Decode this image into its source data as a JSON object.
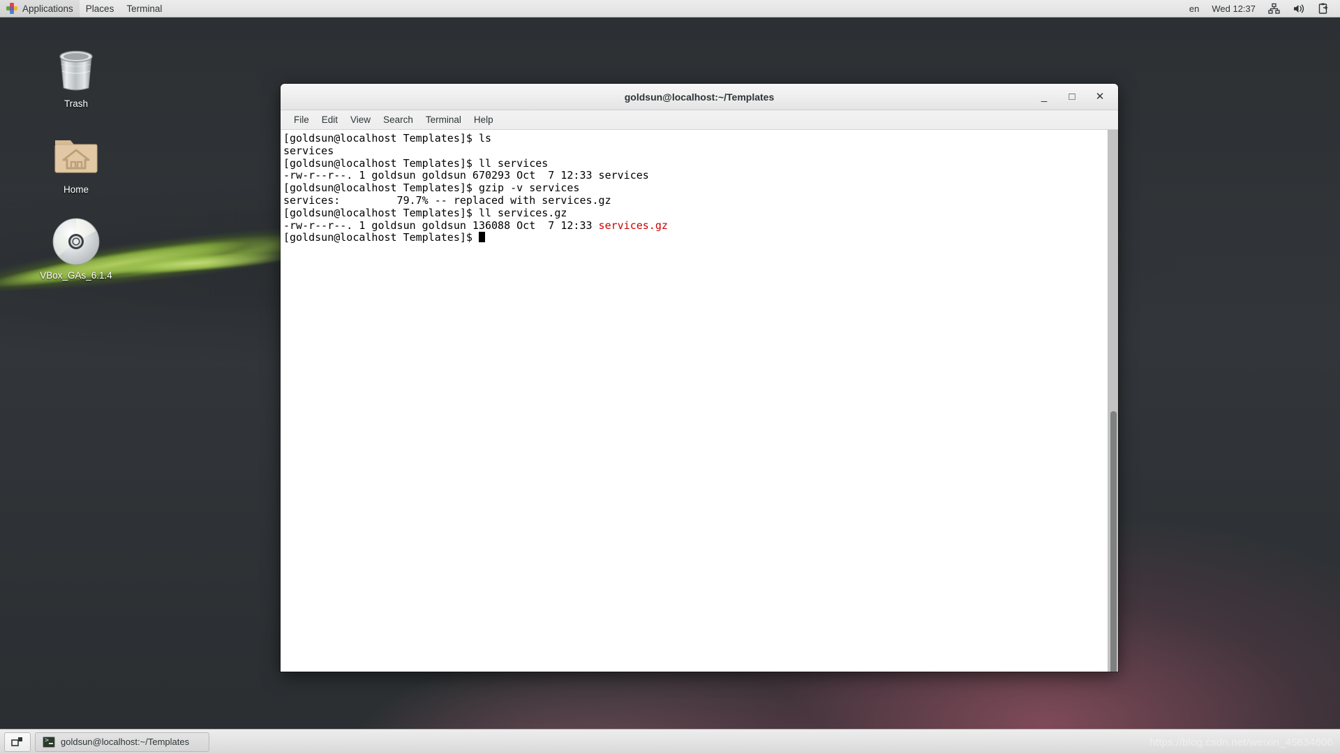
{
  "top_panel": {
    "apps_icon": "applications-pinwheel-icon",
    "menus": [
      {
        "label": "Applications"
      },
      {
        "label": "Places"
      },
      {
        "label": "Terminal"
      }
    ],
    "right": {
      "keyboard_layout": "en",
      "clock": "Wed 12:37",
      "tray_icons": [
        {
          "name": "network-icon"
        },
        {
          "name": "volume-icon"
        },
        {
          "name": "clipboard-icon"
        }
      ]
    }
  },
  "desktop": {
    "icons": [
      {
        "name": "trash-icon",
        "label": "Trash"
      },
      {
        "name": "home-folder-icon",
        "label": "Home"
      },
      {
        "name": "cd-disc-icon",
        "label": "VBox_GAs_6.1.4"
      }
    ]
  },
  "terminal": {
    "title": "goldsun@localhost:~/Templates",
    "window_buttons": {
      "minimize": "_",
      "maximize": "□",
      "close": "✕"
    },
    "menu": [
      {
        "label": "File"
      },
      {
        "label": "Edit"
      },
      {
        "label": "View"
      },
      {
        "label": "Search"
      },
      {
        "label": "Terminal"
      },
      {
        "label": "Help"
      }
    ],
    "prompt": "[goldsun@localhost Templates]$ ",
    "lines": [
      {
        "type": "prompt",
        "command": "ls"
      },
      {
        "type": "output",
        "text": "services"
      },
      {
        "type": "prompt",
        "command": "ll services"
      },
      {
        "type": "output",
        "text": "-rw-r--r--. 1 goldsun goldsun 670293 Oct  7 12:33 services"
      },
      {
        "type": "prompt",
        "command": "gzip -v services"
      },
      {
        "type": "output",
        "text": "services:\t  79.7% -- replaced with services.gz"
      },
      {
        "type": "prompt",
        "command": "ll services.gz"
      },
      {
        "type": "output_mixed",
        "text": "-rw-r--r--. 1 goldsun goldsun 136088 Oct  7 12:33 ",
        "highlight": "services.gz",
        "highlight_color": "#cc0000"
      },
      {
        "type": "prompt_cursor",
        "command": ""
      }
    ],
    "scrollbar": {
      "name": "terminal-scrollbar"
    }
  },
  "taskbar": {
    "show_desktop_icon": "show-desktop-icon",
    "window_button": {
      "icon": "terminal-icon",
      "label": "goldsun@localhost:~/Templates"
    }
  },
  "watermark": {
    "text": "https://blog.csdn.net/weixin_45634606"
  }
}
